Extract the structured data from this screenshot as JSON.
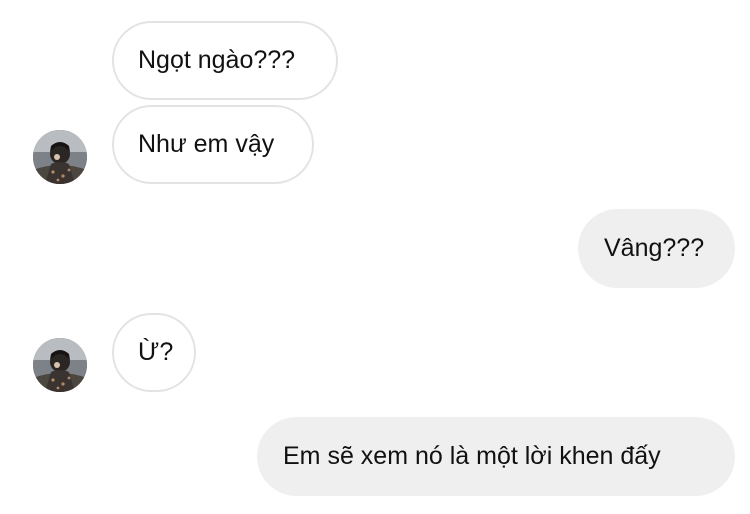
{
  "chat": {
    "messages": [
      {
        "text": "Ngọt ngào???",
        "sender": "other"
      },
      {
        "text": "Như em vậy",
        "sender": "other"
      },
      {
        "text": "Vâng???",
        "sender": "me"
      },
      {
        "text": "Ừ?",
        "sender": "other"
      },
      {
        "text": "Em sẽ xem nó là một lời khen đấy",
        "sender": "me"
      }
    ]
  },
  "colors": {
    "incoming_bubble_bg": "#ffffff",
    "incoming_bubble_border": "#e3e3e3",
    "outgoing_bubble_bg": "#efefef",
    "text": "#111111"
  }
}
